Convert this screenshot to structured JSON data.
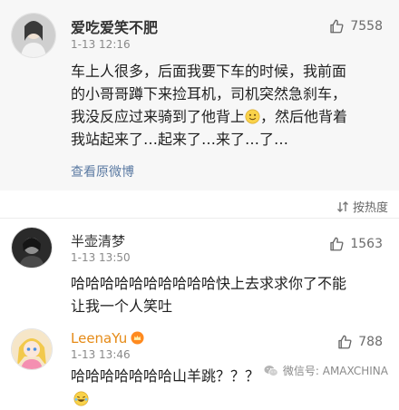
{
  "featured_comment": {
    "author": "爱吃爱笑不肥",
    "time": "1-13 12:16",
    "likes": "7558",
    "text_line1": "车上人很多，后面我要下车的时候，我前面",
    "text_line2": "的小哥哥蹲下来捡耳机，司机突然急刹车，",
    "text_line3_a": "我没反应过来骑到了他背上",
    "text_line3_b": "，然后他背着",
    "text_line4": "我站起来了…起来了…来了…了…",
    "view_original": "查看原微博"
  },
  "sort": {
    "label": "按热度"
  },
  "comments": [
    {
      "author": "半壶清梦",
      "time": "1-13 13:50",
      "likes": "1563",
      "text_line1": "哈哈哈哈哈哈哈哈哈哈快上去求求你了不能",
      "text_line2": "让我一个人笑吐"
    },
    {
      "author": "LeenaYu",
      "time": "1-13 13:46",
      "likes": "788",
      "text_line1": "哈哈哈哈哈哈哈山羊跳？？？"
    }
  ],
  "watermark": {
    "text": "微信号: AMAXCHINA"
  },
  "colors": {
    "featured_bg": "#f7f7f7",
    "link_blue": "#5c7ba3",
    "vip_orange": "#e58a16"
  }
}
